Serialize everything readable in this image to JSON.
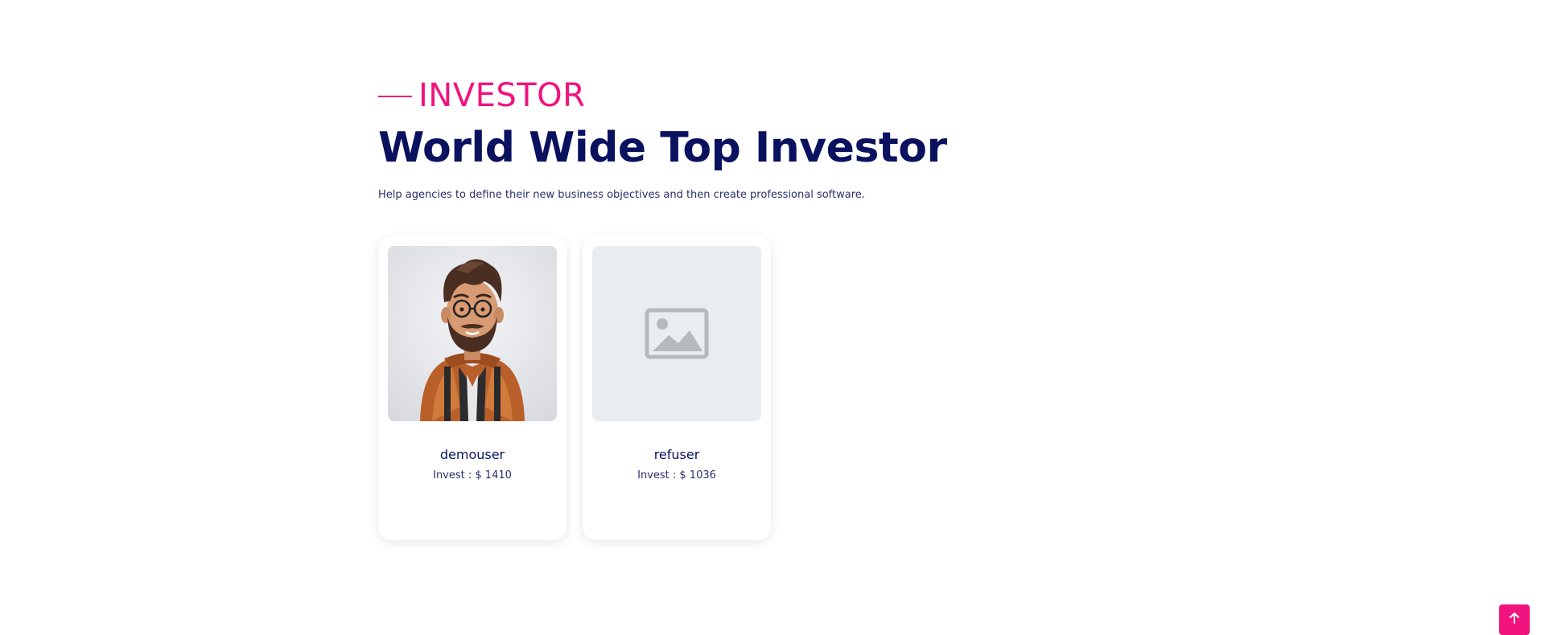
{
  "section": {
    "eyebrow": "INVESTOR",
    "heading": "World Wide Top Investor",
    "subtitle": "Help agencies to define their new business objectives and then create professional software."
  },
  "investors": [
    {
      "name": "demouser",
      "invest": "Invest : $ 1410",
      "image": "avatar-illustration"
    },
    {
      "name": "refuser",
      "invest": "Invest : $ 1036",
      "image": "image-placeholder-icon"
    }
  ],
  "scroll_top": {
    "icon": "arrow-up-icon"
  },
  "colors": {
    "accent": "#f1137e",
    "heading": "#0a115e",
    "text": "#2a2f6d",
    "placeholder_bg": "#e9edf0"
  }
}
